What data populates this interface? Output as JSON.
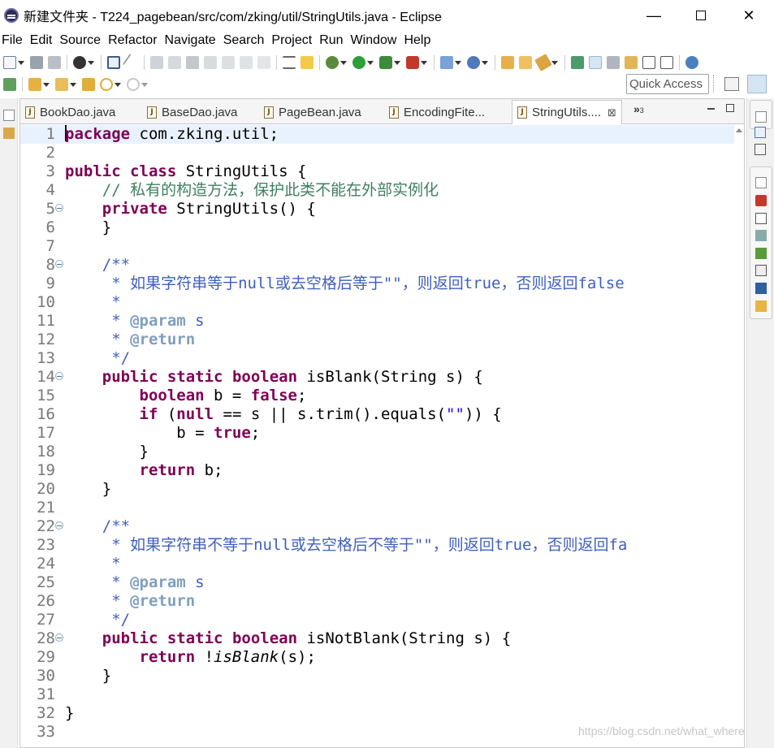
{
  "window": {
    "title": "新建文件夹 - T224_pagebean/src/com/zking/util/StringUtils.java - Eclipse",
    "minimize": "—",
    "close": "✕"
  },
  "menu": [
    "File",
    "Edit",
    "Source",
    "Refactor",
    "Navigate",
    "Search",
    "Project",
    "Run",
    "Window",
    "Help"
  ],
  "quick_access": {
    "label": "Quick Access"
  },
  "tabs": [
    {
      "label": "BookDao.java",
      "active": false
    },
    {
      "label": "BaseDao.java",
      "active": false
    },
    {
      "label": "PageBean.java",
      "active": false
    },
    {
      "label": "EncodingFite...",
      "active": false
    },
    {
      "label": "StringUtils....",
      "active": true
    }
  ],
  "tab_close": "⊠",
  "tab_overflow": {
    "chevron": "»",
    "count": "3"
  },
  "editor": {
    "current_line": 1,
    "lines": [
      {
        "n": "1",
        "fold": false,
        "text": "package com.zking.util;"
      },
      {
        "n": "2",
        "fold": false,
        "text": ""
      },
      {
        "n": "3",
        "fold": false,
        "text": "public class StringUtils {"
      },
      {
        "n": "4",
        "fold": false,
        "text": "    // 私有的构造方法，保护此类不能在外部实例化"
      },
      {
        "n": "5",
        "fold": true,
        "text": "    private StringUtils() {"
      },
      {
        "n": "6",
        "fold": false,
        "text": "    }"
      },
      {
        "n": "7",
        "fold": false,
        "text": ""
      },
      {
        "n": "8",
        "fold": true,
        "text": "    /**"
      },
      {
        "n": "9",
        "fold": false,
        "text": "     * 如果字符串等于null或去空格后等于\"\"，则返回true，否则返回false"
      },
      {
        "n": "10",
        "fold": false,
        "text": "     *"
      },
      {
        "n": "11",
        "fold": false,
        "text": "     * @param s"
      },
      {
        "n": "12",
        "fold": false,
        "text": "     * @return"
      },
      {
        "n": "13",
        "fold": false,
        "text": "     */"
      },
      {
        "n": "14",
        "fold": true,
        "text": "    public static boolean isBlank(String s) {"
      },
      {
        "n": "15",
        "fold": false,
        "text": "        boolean b = false;"
      },
      {
        "n": "16",
        "fold": false,
        "text": "        if (null == s || s.trim().equals(\"\")) {"
      },
      {
        "n": "17",
        "fold": false,
        "text": "            b = true;"
      },
      {
        "n": "18",
        "fold": false,
        "text": "        }"
      },
      {
        "n": "19",
        "fold": false,
        "text": "        return b;"
      },
      {
        "n": "20",
        "fold": false,
        "text": "    }"
      },
      {
        "n": "21",
        "fold": false,
        "text": ""
      },
      {
        "n": "22",
        "fold": true,
        "text": "    /**"
      },
      {
        "n": "23",
        "fold": false,
        "text": "     * 如果字符串不等于null或去空格后不等于\"\"，则返回true，否则返回fa"
      },
      {
        "n": "24",
        "fold": false,
        "text": "     *"
      },
      {
        "n": "25",
        "fold": false,
        "text": "     * @param s"
      },
      {
        "n": "26",
        "fold": false,
        "text": "     * @return"
      },
      {
        "n": "27",
        "fold": false,
        "text": "     */"
      },
      {
        "n": "28",
        "fold": true,
        "text": "    public static boolean isNotBlank(String s) {"
      },
      {
        "n": "29",
        "fold": false,
        "text": "        return !isBlank(s);"
      },
      {
        "n": "30",
        "fold": false,
        "text": "    }"
      },
      {
        "n": "31",
        "fold": false,
        "text": ""
      },
      {
        "n": "32",
        "fold": false,
        "text": "}"
      },
      {
        "n": "33",
        "fold": false,
        "text": ""
      }
    ]
  },
  "watermark": "https://blog.csdn.net/what_where",
  "colors": {
    "keyword": "#7f0055",
    "comment": "#3f7f5f",
    "javadoc": "#3f5fbf",
    "javadoc_tag": "#7f9fbf",
    "string": "#2a00ff",
    "current_line_bg": "#e8f2fe"
  }
}
